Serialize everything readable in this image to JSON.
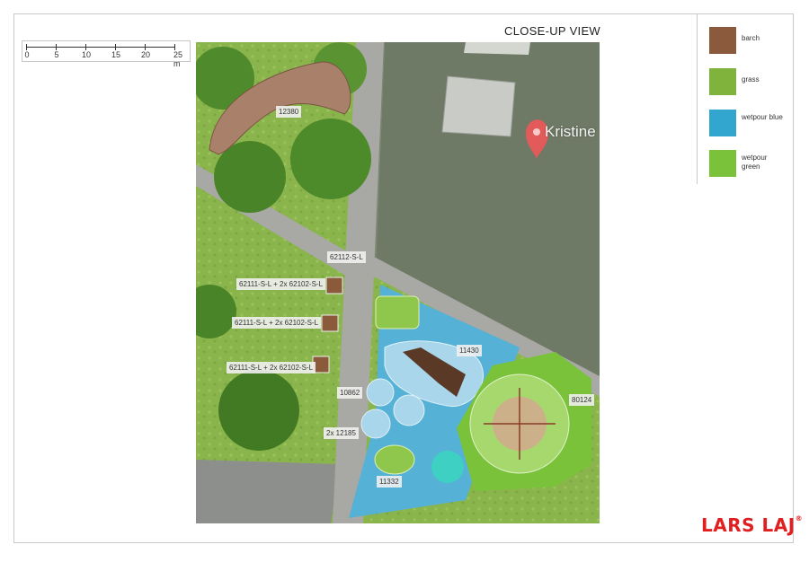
{
  "title": "CLOSE-UP VIEW",
  "scale_bar": {
    "labels": [
      "0",
      "5",
      "10",
      "15",
      "20",
      "25 m"
    ]
  },
  "map": {
    "place_label": "Kristine",
    "item_labels": {
      "l12380": "12380",
      "l62112": "62112-S-L",
      "l62111a": "62111-S-L + 2x 62102-S-L",
      "l62111b": "62111-S-L + 2x 62102-S-L",
      "l62111c": "62111-S-L + 2x 62102-S-L",
      "l11430": "11430",
      "l10862": "10862",
      "l80124": "80124",
      "l12185": "2x 12185",
      "l11332": "11332"
    }
  },
  "legend": [
    {
      "label": "barch",
      "color": "#8b5a3c"
    },
    {
      "label": "grass",
      "color": "#7fb33c"
    },
    {
      "label": "wetpour blue",
      "color": "#33a6d0"
    },
    {
      "label": "wetpour green",
      "color": "#7ac23a"
    }
  ],
  "logo": {
    "text": "LARS LAJ",
    "mark": "®"
  }
}
